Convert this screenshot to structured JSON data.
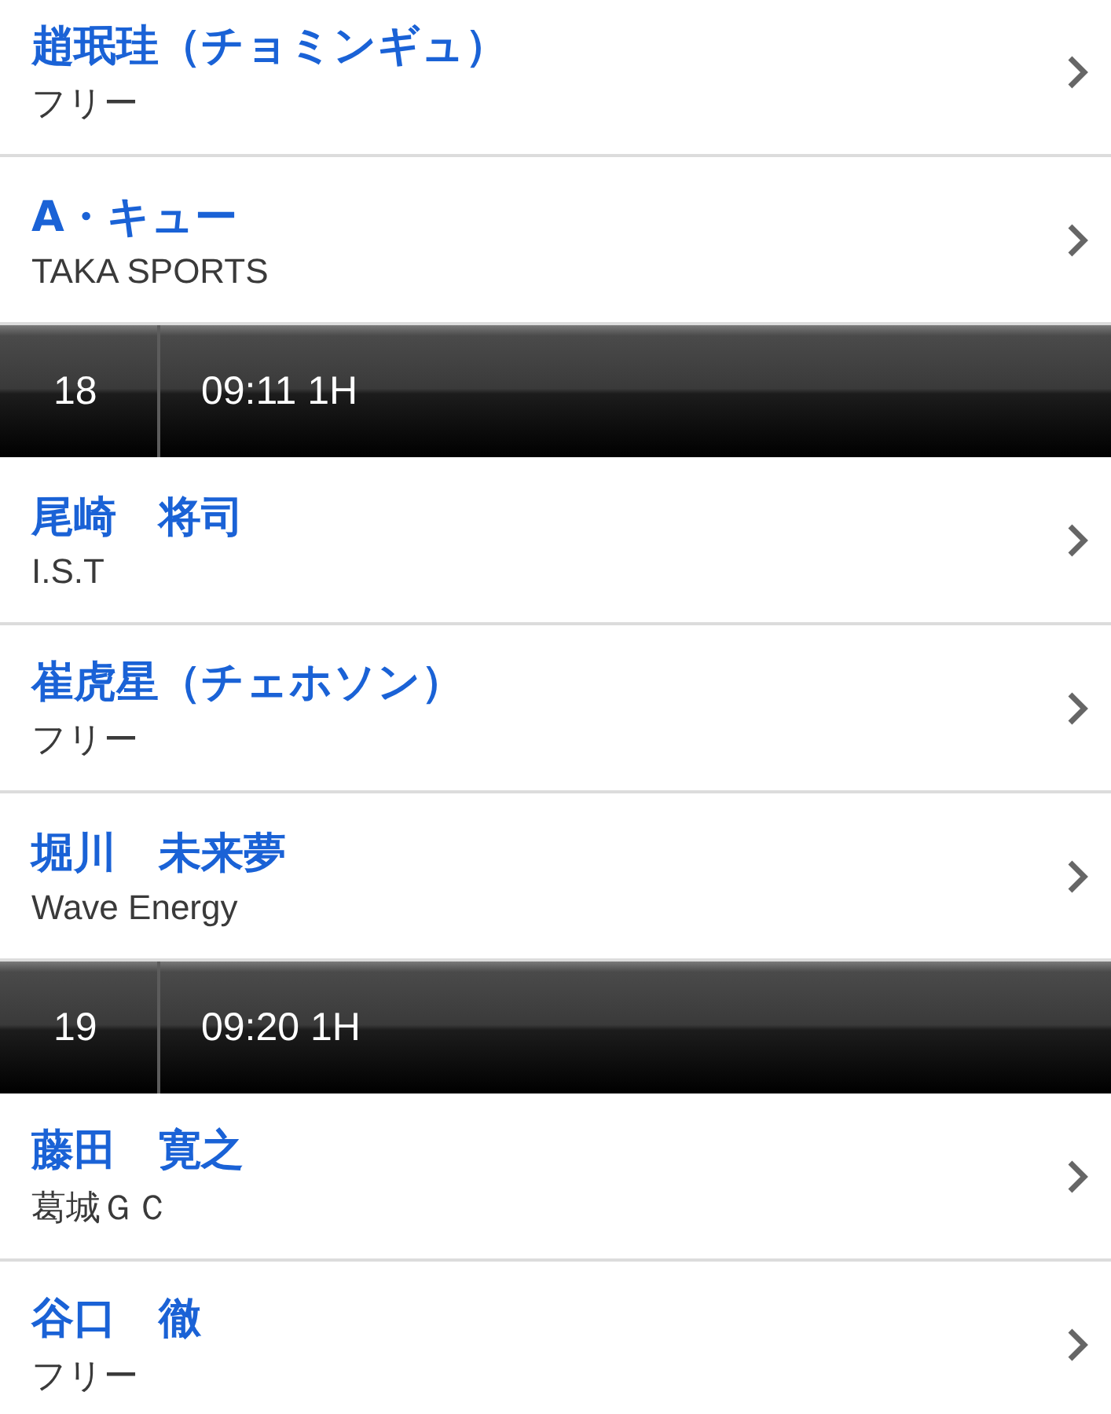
{
  "list": [
    {
      "kind": "player",
      "name": "趙珉珪（チョミンギュ）",
      "affiliation": "フリー"
    },
    {
      "kind": "player",
      "name": "A・キュー",
      "affiliation": "TAKA SPORTS"
    },
    {
      "kind": "header",
      "number": "18",
      "time": "09:11 1H"
    },
    {
      "kind": "player",
      "name": "尾崎　将司",
      "affiliation": "I.S.T"
    },
    {
      "kind": "player",
      "name": "崔虎星（チェホソン）",
      "affiliation": "フリー"
    },
    {
      "kind": "player",
      "name": "堀川　未来夢",
      "affiliation": "Wave Energy"
    },
    {
      "kind": "header",
      "number": "19",
      "time": "09:20 1H"
    },
    {
      "kind": "player",
      "name": "藤田　寛之",
      "affiliation": "葛城ＧＣ"
    },
    {
      "kind": "player",
      "name": "谷口　徹",
      "affiliation": "フリー"
    }
  ]
}
